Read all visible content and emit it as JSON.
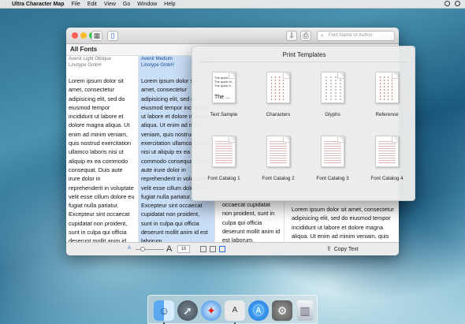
{
  "menubar": {
    "apple": "",
    "app_name": "Ultra Character Map",
    "menus": [
      "File",
      "Edit",
      "View",
      "Go",
      "Window",
      "Help"
    ]
  },
  "window": {
    "search_placeholder": "Font Name or Author",
    "sidebar_title": "All Fonts",
    "columns": [
      {
        "font_name": "Avenir Light Oblique",
        "foundry": "Linotype GmbH",
        "text": "Lorem ipsum dolor sit amet, consectetur adipisicing elit, sed do eiusmod tempor incididunt ut labore et dolore magna aliqua. Ut enim ad minim veniam, quis nostrud exercitation ullamco laboris nisi ut aliquip ex ea commodo consequat. Duis aute irure dolor in reprehenderit in voluptate velit esse cillum dolore eu fugiat nulla pariatur. Excepteur sint occaecat cupidatat non proident, sunt in culpa qui officia deserunt mollit anim id est laborum."
      },
      {
        "font_name": "Avenir Medium",
        "foundry": "Linotype GmbH",
        "text": "Lorem ipsum dolor sit amet, consectetur adipisicing elit, sed do eiusmod tempor incididunt ut labore et dolore magna aliqua. Ut enim ad minim veniam, quis nostrud exercitation ullamco laboris nisi ut aliquip ex ea commodo consequat. Duis aute irure dolor in reprehenderit in voluptate velit esse cillum dolore eu fugiat nulla pariatur. Excepteur sint occaecat cupidatat non proident, sunt in culpa qui officia deserunt mollit anim id est laborum."
      },
      {
        "font_name": "",
        "foundry": "",
        "text": "occaecat cupidatat non proident, sunt in culpa qui officia deserunt mollit anim id est laborum."
      }
    ],
    "preview_text": "Lorem ipsum dolor sit amet, consectetur adipisicing elit, sed do eiusmod tempor incididunt ut labore et dolore magna aliqua. Ut enim ad minim veniam, quis nostrud exercitation ullamco laboris nisi ut aliquip ex ea commodo",
    "bottom": {
      "small_a": "A",
      "large_a": "A",
      "font_size": "16",
      "copy_text": "Copy Text"
    }
  },
  "print_templates": {
    "title": "Print Templates",
    "items": [
      {
        "label": "Text Sample",
        "kind": "sample"
      },
      {
        "label": "Characters",
        "kind": "dots"
      },
      {
        "label": "Glyphs",
        "kind": "grid"
      },
      {
        "label": "Reference",
        "kind": "dots"
      },
      {
        "label": "Font Catalog 1",
        "kind": "lines"
      },
      {
        "label": "Font Catalog 2",
        "kind": "lines"
      },
      {
        "label": "Font Catalog 3",
        "kind": "lines"
      },
      {
        "label": "Font Catalog 4",
        "kind": "lines"
      }
    ],
    "sample_lines": [
      "The quick br...",
      "The quick br...",
      "The quick b..."
    ],
    "sample_big": "The ..."
  },
  "dock": {
    "items": [
      "finder-icon",
      "launchpad-icon",
      "safari-icon",
      "ultra-character-map-icon",
      "app-store-icon",
      "system-preferences-icon",
      "trash-icon"
    ],
    "ucm_glyph": "A"
  },
  "colors": {
    "accent": "#2a6fd6",
    "selection": "#c9def7"
  }
}
